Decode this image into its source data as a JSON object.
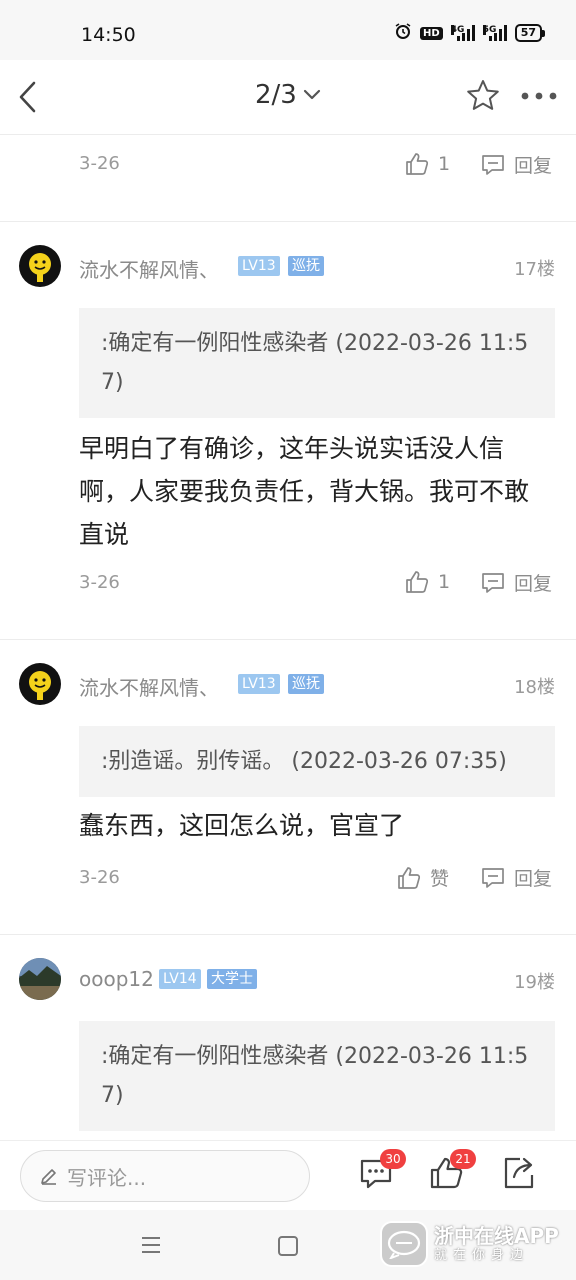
{
  "status_bar": {
    "time": "14:50",
    "hd": "HD",
    "net1": "4G",
    "net2": "5G",
    "battery": "57"
  },
  "nav": {
    "page_indicator": "2/3"
  },
  "comments": [
    {
      "date": "3-26",
      "like_label": "1",
      "reply_label": "回复"
    },
    {
      "username": "流水不解风情、",
      "level": "LV13",
      "role": "巡抚",
      "floor": "17楼",
      "quote": ":确定有一例阳性感染者 (2022-03-26 11:57)",
      "body": "早明白了有确诊，这年头说实话没人信啊，人家要我负责任，背大锅。我可不敢直说",
      "date": "3-26",
      "like_label": "1",
      "reply_label": "回复"
    },
    {
      "username": "流水不解风情、",
      "level": "LV13",
      "role": "巡抚",
      "floor": "18楼",
      "quote": ":别造谣。别传谣。 (2022-03-26 07:35)",
      "body": "蠢东西，这回怎么说，官宣了",
      "date": "3-26",
      "like_label": "赞",
      "reply_label": "回复"
    },
    {
      "username": "ooop12",
      "level": "LV14",
      "role": "大学士",
      "floor": "19楼",
      "quote": ":确定有一例阳性感染者 (2022-03-26 11:57)"
    }
  ],
  "bottom_bar": {
    "placeholder": "写评论...",
    "comment_count": "30",
    "like_count": "21"
  },
  "watermark": {
    "title": "浙中在线APP",
    "subtitle": "就在你身边"
  },
  "colors": {
    "badge_level": "#9cc7f0",
    "badge_role": "#7fb0e8",
    "notification": "#f04040",
    "text_muted": "#9a9a9a"
  }
}
